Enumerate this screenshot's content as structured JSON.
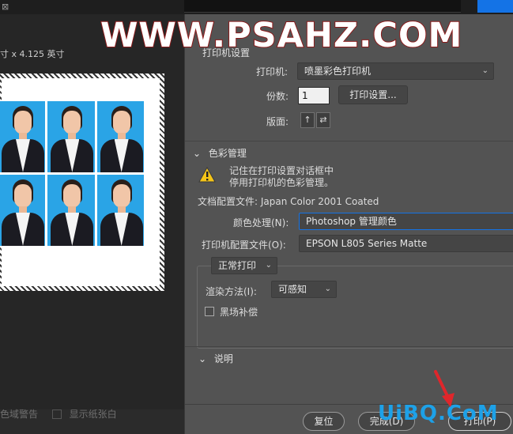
{
  "header": {
    "close_glyph": "⊠"
  },
  "preview": {
    "paper_size_text": "寸 x 4.125 英寸",
    "photo_count": 6,
    "show_gamut_warning": "色域警告",
    "show_paper_white": "显示纸张白"
  },
  "printer_setup": {
    "section_title": "打印机设置",
    "printer_label": "打印机:",
    "printer_value": "喷墨彩色打印机",
    "copies_label": "份数:",
    "copies_value": "1",
    "print_settings_button": "打印设置...",
    "layout_label": "版面:"
  },
  "color_management": {
    "section_title": "色彩管理",
    "warning_line1": "记住在打印设置对话框中",
    "warning_line2": "停用打印机的色彩管理。",
    "doc_profile_text": "文档配置文件: Japan Color 2001 Coated",
    "color_handling_label": "颜色处理(N):",
    "color_handling_value": "Photoshop 管理颜色",
    "printer_profile_label": "打印机配置文件(O):",
    "printer_profile_value": "EPSON L805 Series Matte",
    "proof_mode_value": "正常打印",
    "render_intent_label": "渲染方法(I):",
    "render_intent_value": "可感知",
    "black_point_label": "黑场补偿"
  },
  "description": {
    "section_title": "说明"
  },
  "footer": {
    "reset_button": "复位",
    "done_button": "完成(D)",
    "print_button": "打印(P)"
  },
  "watermarks": {
    "top": "WWW.PSAHZ.COM",
    "bottom": "UiBQ.CoM"
  },
  "colors": {
    "accent": "#1473e6",
    "photo_bg": "#2aa4e6",
    "panel": "#535353",
    "warning": "#f5c518",
    "arrow": "#e0262b"
  }
}
